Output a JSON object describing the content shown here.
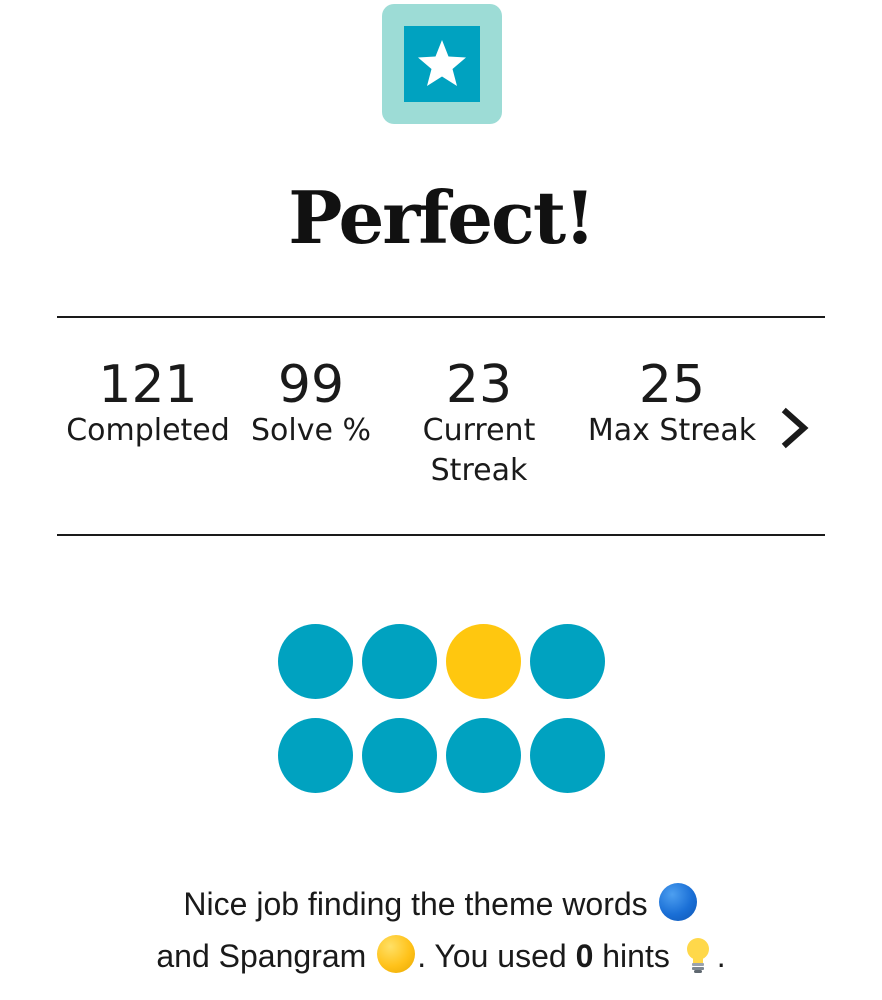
{
  "result": {
    "title": "Perfect!"
  },
  "stats": [
    {
      "value": "121",
      "label": "Completed"
    },
    {
      "value": "99",
      "label": "Solve %"
    },
    {
      "value": "23",
      "label": "Current Streak"
    },
    {
      "value": "25",
      "label": "Max Streak"
    }
  ],
  "progress_dots": {
    "rows": [
      [
        "theme",
        "theme",
        "spangram",
        "theme"
      ],
      [
        "theme",
        "theme",
        "theme",
        "theme"
      ]
    ],
    "colors": {
      "theme": "#00a2c0",
      "spangram": "#ffc70f"
    }
  },
  "message": {
    "line1_text": "Nice job finding the theme words",
    "line2_prefix": "and Spangram",
    "line2_used": ". You used",
    "hints_count": "0",
    "hints_word": "hints",
    "end_period": "."
  },
  "icons": {
    "badge": "star-icon",
    "next": "chevron-right-icon",
    "theme_word": "blue-circle-icon",
    "spangram": "yellow-circle-icon",
    "hint": "lightbulb-icon"
  },
  "colors": {
    "badge_outer": "#9ddcd6",
    "badge_inner": "#00a2c0",
    "theme_dot": "#00a2c0",
    "spangram_dot": "#ffc70f"
  }
}
